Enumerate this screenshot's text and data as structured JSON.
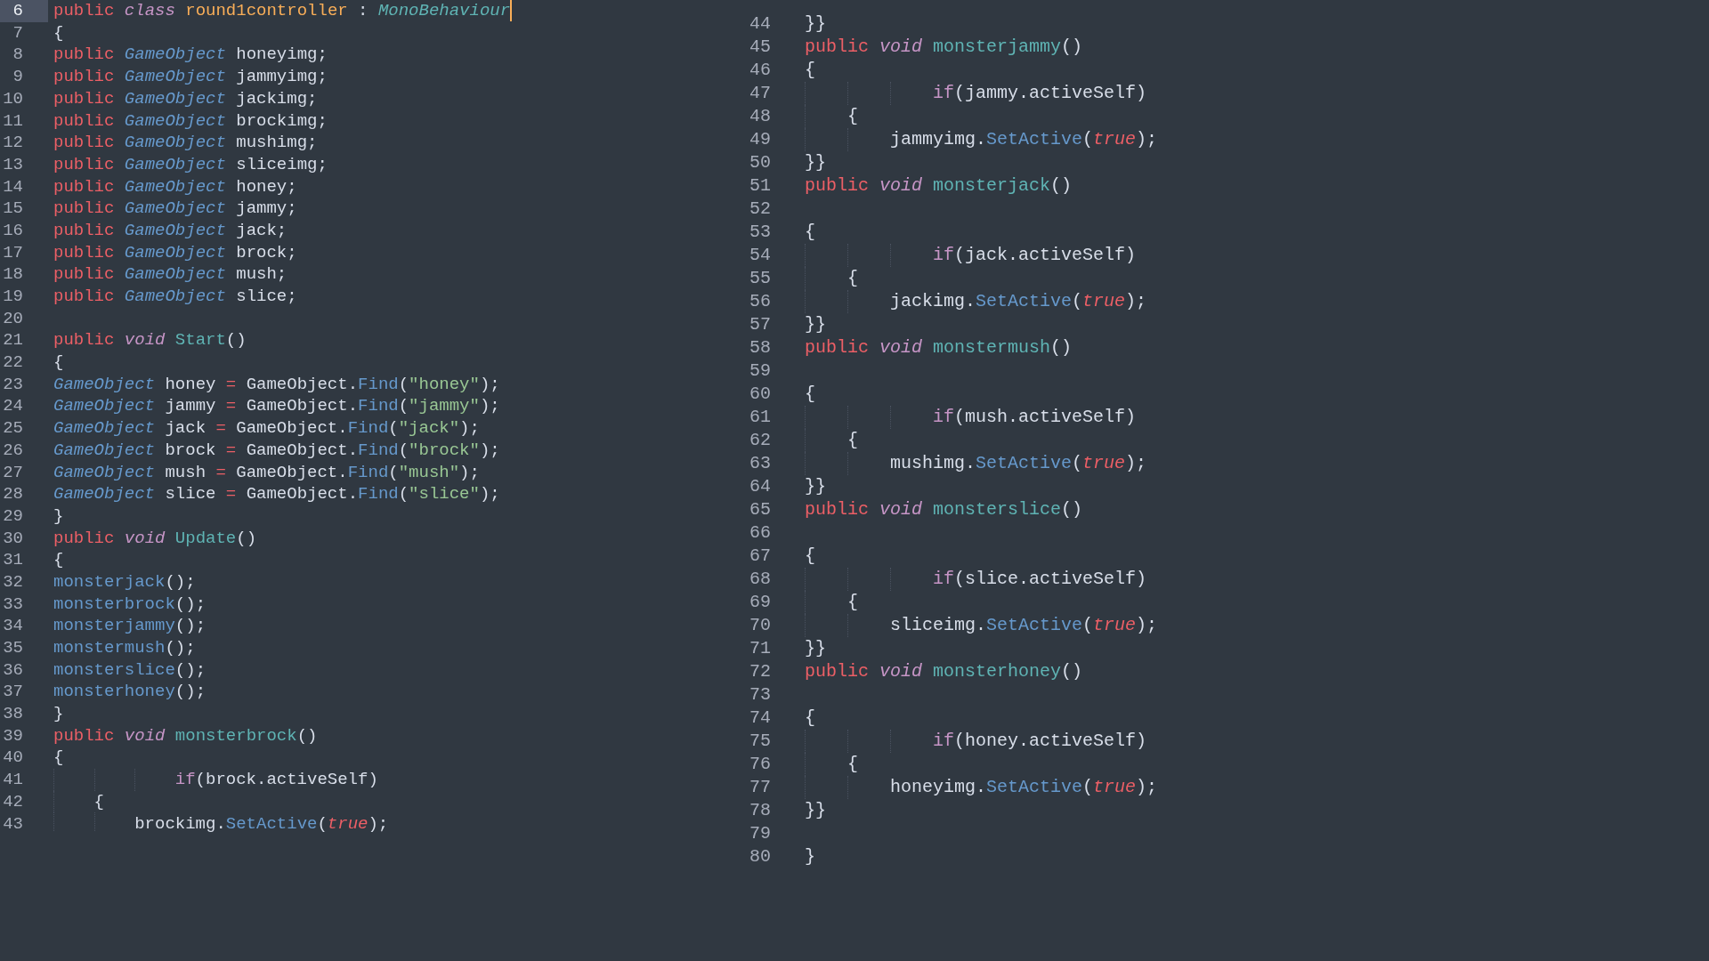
{
  "left_pane": {
    "lines": [
      {
        "number": "6",
        "kind": "top",
        "current": true,
        "tokens": [
          {
            "text": "public ",
            "kind": "kw"
          },
          {
            "text": "class ",
            "kind": "kwi"
          },
          {
            "text": "round1controller ",
            "kind": "cls"
          },
          {
            "text": ": ",
            "kind": "plain"
          },
          {
            "text": "MonoBehaviour",
            "kind": "base"
          }
        ]
      },
      {
        "number": "7",
        "kind": "top",
        "current": false,
        "tokens": [
          {
            "text": "{",
            "kind": "plain"
          }
        ]
      },
      {
        "number": "8",
        "kind": "top",
        "current": false,
        "tokens": [
          {
            "text": "public ",
            "kind": "kw"
          },
          {
            "text": "GameObject ",
            "kind": "type"
          },
          {
            "text": "honeyimg;",
            "kind": "plain"
          }
        ]
      },
      {
        "number": "9",
        "kind": "top",
        "current": false,
        "tokens": [
          {
            "text": "public ",
            "kind": "kw"
          },
          {
            "text": "GameObject ",
            "kind": "type"
          },
          {
            "text": "jammyimg;",
            "kind": "plain"
          }
        ]
      },
      {
        "number": "10",
        "kind": "top",
        "current": false,
        "tokens": [
          {
            "text": "public ",
            "kind": "kw"
          },
          {
            "text": "GameObject ",
            "kind": "type"
          },
          {
            "text": "jackimg;",
            "kind": "plain"
          }
        ]
      },
      {
        "number": "11",
        "kind": "top",
        "current": false,
        "tokens": [
          {
            "text": "public ",
            "kind": "kw"
          },
          {
            "text": "GameObject ",
            "kind": "type"
          },
          {
            "text": "brockimg;",
            "kind": "plain"
          }
        ]
      },
      {
        "number": "12",
        "kind": "top",
        "current": false,
        "tokens": [
          {
            "text": "public ",
            "kind": "kw"
          },
          {
            "text": "GameObject ",
            "kind": "type"
          },
          {
            "text": "mushimg;",
            "kind": "plain"
          }
        ]
      },
      {
        "number": "13",
        "kind": "top",
        "current": false,
        "tokens": [
          {
            "text": "public ",
            "kind": "kw"
          },
          {
            "text": "GameObject ",
            "kind": "type"
          },
          {
            "text": "sliceimg;",
            "kind": "plain"
          }
        ]
      },
      {
        "number": "14",
        "kind": "top",
        "current": false,
        "tokens": [
          {
            "text": "public ",
            "kind": "kw"
          },
          {
            "text": "GameObject ",
            "kind": "type"
          },
          {
            "text": "honey;",
            "kind": "plain"
          }
        ]
      },
      {
        "number": "15",
        "kind": "top",
        "current": false,
        "tokens": [
          {
            "text": "public ",
            "kind": "kw"
          },
          {
            "text": "GameObject ",
            "kind": "type"
          },
          {
            "text": "jammy;",
            "kind": "plain"
          }
        ]
      },
      {
        "number": "16",
        "kind": "top",
        "current": false,
        "tokens": [
          {
            "text": "public ",
            "kind": "kw"
          },
          {
            "text": "GameObject ",
            "kind": "type"
          },
          {
            "text": "jack;",
            "kind": "plain"
          }
        ]
      },
      {
        "number": "17",
        "kind": "top",
        "current": false,
        "tokens": [
          {
            "text": "public ",
            "kind": "kw"
          },
          {
            "text": "GameObject ",
            "kind": "type"
          },
          {
            "text": "brock;",
            "kind": "plain"
          }
        ]
      },
      {
        "number": "18",
        "kind": "top",
        "current": false,
        "tokens": [
          {
            "text": "public ",
            "kind": "kw"
          },
          {
            "text": "GameObject ",
            "kind": "type"
          },
          {
            "text": "mush;",
            "kind": "plain"
          }
        ]
      },
      {
        "number": "19",
        "kind": "top",
        "current": false,
        "tokens": [
          {
            "text": "public ",
            "kind": "kw"
          },
          {
            "text": "GameObject ",
            "kind": "type"
          },
          {
            "text": "slice;",
            "kind": "plain"
          }
        ]
      },
      {
        "number": "20",
        "kind": "top",
        "current": false
      },
      {
        "number": "21",
        "kind": "top",
        "current": false,
        "tokens": [
          {
            "text": "public ",
            "kind": "kw"
          },
          {
            "text": "void ",
            "kind": "kwi"
          },
          {
            "text": "Start",
            "kind": "fn"
          },
          {
            "text": "()",
            "kind": "plain"
          }
        ]
      },
      {
        "number": "22",
        "kind": "top",
        "current": false,
        "tokens": [
          {
            "text": "{",
            "kind": "plain"
          }
        ]
      },
      {
        "number": "23",
        "kind": "top",
        "current": false,
        "tokens": [
          {
            "text": "GameObject ",
            "kind": "type"
          },
          {
            "text": "honey ",
            "kind": "plain"
          },
          {
            "text": "= ",
            "kind": "op"
          },
          {
            "text": "GameObject.",
            "kind": "plain"
          },
          {
            "text": "Find",
            "kind": "call"
          },
          {
            "text": "(",
            "kind": "plain"
          },
          {
            "text": "\"honey\"",
            "kind": "str"
          },
          {
            "text": ");",
            "kind": "plain"
          }
        ]
      },
      {
        "number": "24",
        "kind": "top",
        "current": false,
        "tokens": [
          {
            "text": "GameObject ",
            "kind": "type"
          },
          {
            "text": "jammy ",
            "kind": "plain"
          },
          {
            "text": "= ",
            "kind": "op"
          },
          {
            "text": "GameObject.",
            "kind": "plain"
          },
          {
            "text": "Find",
            "kind": "call"
          },
          {
            "text": "(",
            "kind": "plain"
          },
          {
            "text": "\"jammy\"",
            "kind": "str"
          },
          {
            "text": ");",
            "kind": "plain"
          }
        ]
      },
      {
        "number": "25",
        "kind": "top",
        "current": false,
        "tokens": [
          {
            "text": "GameObject ",
            "kind": "type"
          },
          {
            "text": "jack ",
            "kind": "plain"
          },
          {
            "text": "= ",
            "kind": "op"
          },
          {
            "text": "GameObject.",
            "kind": "plain"
          },
          {
            "text": "Find",
            "kind": "call"
          },
          {
            "text": "(",
            "kind": "plain"
          },
          {
            "text": "\"jack\"",
            "kind": "str"
          },
          {
            "text": ");",
            "kind": "plain"
          }
        ]
      },
      {
        "number": "26",
        "kind": "top",
        "current": false,
        "tokens": [
          {
            "text": "GameObject ",
            "kind": "type"
          },
          {
            "text": "brock ",
            "kind": "plain"
          },
          {
            "text": "= ",
            "kind": "op"
          },
          {
            "text": "GameObject.",
            "kind": "plain"
          },
          {
            "text": "Find",
            "kind": "call"
          },
          {
            "text": "(",
            "kind": "plain"
          },
          {
            "text": "\"brock\"",
            "kind": "str"
          },
          {
            "text": ");",
            "kind": "plain"
          }
        ]
      },
      {
        "number": "27",
        "kind": "top",
        "current": false,
        "tokens": [
          {
            "text": "GameObject ",
            "kind": "type"
          },
          {
            "text": "mush ",
            "kind": "plain"
          },
          {
            "text": "= ",
            "kind": "op"
          },
          {
            "text": "GameObject.",
            "kind": "plain"
          },
          {
            "text": "Find",
            "kind": "call"
          },
          {
            "text": "(",
            "kind": "plain"
          },
          {
            "text": "\"mush\"",
            "kind": "str"
          },
          {
            "text": ");",
            "kind": "plain"
          }
        ]
      },
      {
        "number": "28",
        "kind": "top",
        "current": false,
        "tokens": [
          {
            "text": "GameObject ",
            "kind": "type"
          },
          {
            "text": "slice ",
            "kind": "plain"
          },
          {
            "text": "= ",
            "kind": "op"
          },
          {
            "text": "GameObject.",
            "kind": "plain"
          },
          {
            "text": "Find",
            "kind": "call"
          },
          {
            "text": "(",
            "kind": "plain"
          },
          {
            "text": "\"slice\"",
            "kind": "str"
          },
          {
            "text": ");",
            "kind": "plain"
          }
        ]
      },
      {
        "number": "29",
        "kind": "top",
        "current": false,
        "tokens": [
          {
            "text": "}",
            "kind": "plain"
          }
        ]
      },
      {
        "number": "30",
        "kind": "top",
        "current": false,
        "tokens": [
          {
            "text": "public ",
            "kind": "kw"
          },
          {
            "text": "void ",
            "kind": "kwi"
          },
          {
            "text": "Update",
            "kind": "fn"
          },
          {
            "text": "()",
            "kind": "plain"
          }
        ]
      },
      {
        "number": "31",
        "kind": "top",
        "current": false,
        "tokens": [
          {
            "text": "{",
            "kind": "plain"
          }
        ]
      },
      {
        "number": "32",
        "kind": "top",
        "current": false,
        "tokens": [
          {
            "text": "monsterjack",
            "kind": "call"
          },
          {
            "text": "();",
            "kind": "plain"
          }
        ]
      },
      {
        "number": "33",
        "kind": "top",
        "current": false,
        "tokens": [
          {
            "text": "monsterbrock",
            "kind": "call"
          },
          {
            "text": "();",
            "kind": "plain"
          }
        ]
      },
      {
        "number": "34",
        "kind": "top",
        "current": false,
        "tokens": [
          {
            "text": "monsterjammy",
            "kind": "call"
          },
          {
            "text": "();",
            "kind": "plain"
          }
        ]
      },
      {
        "number": "35",
        "kind": "top",
        "current": false,
        "tokens": [
          {
            "text": "monstermush",
            "kind": "call"
          },
          {
            "text": "();",
            "kind": "plain"
          }
        ]
      },
      {
        "number": "36",
        "kind": "top",
        "current": false,
        "tokens": [
          {
            "text": "monsterslice",
            "kind": "call"
          },
          {
            "text": "();",
            "kind": "plain"
          }
        ]
      },
      {
        "number": "37",
        "kind": "top",
        "current": false,
        "tokens": [
          {
            "text": "monsterhoney",
            "kind": "call"
          },
          {
            "text": "();",
            "kind": "plain"
          }
        ]
      },
      {
        "number": "38",
        "kind": "top",
        "current": false,
        "tokens": [
          {
            "text": "}",
            "kind": "plain"
          }
        ]
      },
      {
        "number": "39",
        "kind": "top",
        "current": false,
        "tokens": [
          {
            "text": "public ",
            "kind": "kw"
          },
          {
            "text": "void ",
            "kind": "kwi"
          },
          {
            "text": "monsterbrock",
            "kind": "fn"
          },
          {
            "text": "()",
            "kind": "plain"
          }
        ]
      },
      {
        "number": "40",
        "kind": "top",
        "current": false,
        "tokens": [
          {
            "text": "{",
            "kind": "plain"
          }
        ]
      },
      {
        "number": "41",
        "kind": "condition",
        "current": false,
        "tokens": [
          {
            "text": "if",
            "kind": "ctrl"
          },
          {
            "text": "(brock.activeSelf)",
            "kind": "plain"
          }
        ]
      },
      {
        "number": "42",
        "kind": "brace",
        "current": false,
        "tokens": [
          {
            "text": "{",
            "kind": "plain"
          }
        ]
      },
      {
        "number": "43",
        "kind": "statement",
        "current": false,
        "tokens": [
          {
            "text": "brockimg.",
            "kind": "plain"
          },
          {
            "text": "SetActive",
            "kind": "call"
          },
          {
            "text": "(",
            "kind": "plain"
          },
          {
            "text": "true",
            "kind": "bool"
          },
          {
            "text": ");",
            "kind": "plain"
          }
        ]
      }
    ]
  },
  "right_pane": {
    "lines": [
      {
        "number": "44",
        "kind": "top",
        "current": false,
        "tokens": [
          {
            "text": "}}",
            "kind": "plain"
          }
        ]
      },
      {
        "number": "45",
        "kind": "top",
        "current": false,
        "tokens": [
          {
            "text": "public ",
            "kind": "kw"
          },
          {
            "text": "void ",
            "kind": "kwi"
          },
          {
            "text": "monsterjammy",
            "kind": "fn"
          },
          {
            "text": "()",
            "kind": "plain"
          }
        ]
      },
      {
        "number": "46",
        "kind": "top",
        "current": false,
        "tokens": [
          {
            "text": "{",
            "kind": "plain"
          }
        ]
      },
      {
        "number": "47",
        "kind": "condition",
        "current": false,
        "tokens": [
          {
            "text": "if",
            "kind": "ctrl"
          },
          {
            "text": "(jammy.activeSelf)",
            "kind": "plain"
          }
        ]
      },
      {
        "number": "48",
        "kind": "brace",
        "current": false,
        "tokens": [
          {
            "text": "{",
            "kind": "plain"
          }
        ]
      },
      {
        "number": "49",
        "kind": "statement",
        "current": false,
        "tokens": [
          {
            "text": "jammyimg.",
            "kind": "plain"
          },
          {
            "text": "SetActive",
            "kind": "call"
          },
          {
            "text": "(",
            "kind": "plain"
          },
          {
            "text": "true",
            "kind": "bool"
          },
          {
            "text": ");",
            "kind": "plain"
          }
        ]
      },
      {
        "number": "50",
        "kind": "top",
        "current": false,
        "tokens": [
          {
            "text": "}}",
            "kind": "plain"
          }
        ]
      },
      {
        "number": "51",
        "kind": "top",
        "current": false,
        "tokens": [
          {
            "text": "public ",
            "kind": "kw"
          },
          {
            "text": "void ",
            "kind": "kwi"
          },
          {
            "text": "monsterjack",
            "kind": "fn"
          },
          {
            "text": "()",
            "kind": "plain"
          }
        ]
      },
      {
        "number": "52",
        "kind": "top",
        "current": false
      },
      {
        "number": "53",
        "kind": "top",
        "current": false,
        "tokens": [
          {
            "text": "{",
            "kind": "plain"
          }
        ]
      },
      {
        "number": "54",
        "kind": "condition",
        "current": false,
        "tokens": [
          {
            "text": "if",
            "kind": "ctrl"
          },
          {
            "text": "(jack.activeSelf)",
            "kind": "plain"
          }
        ]
      },
      {
        "number": "55",
        "kind": "brace",
        "current": false,
        "tokens": [
          {
            "text": "{",
            "kind": "plain"
          }
        ]
      },
      {
        "number": "56",
        "kind": "statement",
        "current": false,
        "tokens": [
          {
            "text": "jackimg.",
            "kind": "plain"
          },
          {
            "text": "SetActive",
            "kind": "call"
          },
          {
            "text": "(",
            "kind": "plain"
          },
          {
            "text": "true",
            "kind": "bool"
          },
          {
            "text": ");",
            "kind": "plain"
          }
        ]
      },
      {
        "number": "57",
        "kind": "top",
        "current": false,
        "tokens": [
          {
            "text": "}}",
            "kind": "plain"
          }
        ]
      },
      {
        "number": "58",
        "kind": "top",
        "current": false,
        "tokens": [
          {
            "text": "public ",
            "kind": "kw"
          },
          {
            "text": "void ",
            "kind": "kwi"
          },
          {
            "text": "monstermush",
            "kind": "fn"
          },
          {
            "text": "()",
            "kind": "plain"
          }
        ]
      },
      {
        "number": "59",
        "kind": "top",
        "current": false
      },
      {
        "number": "60",
        "kind": "top",
        "current": false,
        "tokens": [
          {
            "text": "{",
            "kind": "plain"
          }
        ]
      },
      {
        "number": "61",
        "kind": "condition",
        "current": false,
        "tokens": [
          {
            "text": "if",
            "kind": "ctrl"
          },
          {
            "text": "(mush.activeSelf)",
            "kind": "plain"
          }
        ]
      },
      {
        "number": "62",
        "kind": "brace",
        "current": false,
        "tokens": [
          {
            "text": "{",
            "kind": "plain"
          }
        ]
      },
      {
        "number": "63",
        "kind": "statement",
        "current": false,
        "tokens": [
          {
            "text": "mushimg.",
            "kind": "plain"
          },
          {
            "text": "SetActive",
            "kind": "call"
          },
          {
            "text": "(",
            "kind": "plain"
          },
          {
            "text": "true",
            "kind": "bool"
          },
          {
            "text": ");",
            "kind": "plain"
          }
        ]
      },
      {
        "number": "64",
        "kind": "top",
        "current": false,
        "tokens": [
          {
            "text": "}}",
            "kind": "plain"
          }
        ]
      },
      {
        "number": "65",
        "kind": "top",
        "current": false,
        "tokens": [
          {
            "text": "public ",
            "kind": "kw"
          },
          {
            "text": "void ",
            "kind": "kwi"
          },
          {
            "text": "monsterslice",
            "kind": "fn"
          },
          {
            "text": "()",
            "kind": "plain"
          }
        ]
      },
      {
        "number": "66",
        "kind": "top",
        "current": false
      },
      {
        "number": "67",
        "kind": "top",
        "current": false,
        "tokens": [
          {
            "text": "{",
            "kind": "plain"
          }
        ]
      },
      {
        "number": "68",
        "kind": "condition",
        "current": false,
        "tokens": [
          {
            "text": "if",
            "kind": "ctrl"
          },
          {
            "text": "(slice.activeSelf)",
            "kind": "plain"
          }
        ]
      },
      {
        "number": "69",
        "kind": "brace",
        "current": false,
        "tokens": [
          {
            "text": "{",
            "kind": "plain"
          }
        ]
      },
      {
        "number": "70",
        "kind": "statement",
        "current": false,
        "tokens": [
          {
            "text": "sliceimg.",
            "kind": "plain"
          },
          {
            "text": "SetActive",
            "kind": "call"
          },
          {
            "text": "(",
            "kind": "plain"
          },
          {
            "text": "true",
            "kind": "bool"
          },
          {
            "text": ");",
            "kind": "plain"
          }
        ]
      },
      {
        "number": "71",
        "kind": "top",
        "current": false,
        "tokens": [
          {
            "text": "}}",
            "kind": "plain"
          }
        ]
      },
      {
        "number": "72",
        "kind": "top",
        "current": false,
        "tokens": [
          {
            "text": "public ",
            "kind": "kw"
          },
          {
            "text": "void ",
            "kind": "kwi"
          },
          {
            "text": "monsterhoney",
            "kind": "fn"
          },
          {
            "text": "()",
            "kind": "plain"
          }
        ]
      },
      {
        "number": "73",
        "kind": "top",
        "current": false
      },
      {
        "number": "74",
        "kind": "top",
        "current": false,
        "tokens": [
          {
            "text": "{",
            "kind": "plain"
          }
        ]
      },
      {
        "number": "75",
        "kind": "condition",
        "current": false,
        "tokens": [
          {
            "text": "if",
            "kind": "ctrl"
          },
          {
            "text": "(honey.activeSelf)",
            "kind": "plain"
          }
        ]
      },
      {
        "number": "76",
        "kind": "brace",
        "current": false,
        "tokens": [
          {
            "text": "{",
            "kind": "plain"
          }
        ]
      },
      {
        "number": "77",
        "kind": "statement",
        "current": false,
        "tokens": [
          {
            "text": "honeyimg.",
            "kind": "plain"
          },
          {
            "text": "SetActive",
            "kind": "call"
          },
          {
            "text": "(",
            "kind": "plain"
          },
          {
            "text": "true",
            "kind": "bool"
          },
          {
            "text": ");",
            "kind": "plain"
          }
        ]
      },
      {
        "number": "78",
        "kind": "top",
        "current": false,
        "tokens": [
          {
            "text": "}}",
            "kind": "plain"
          }
        ]
      },
      {
        "number": "79",
        "kind": "top",
        "current": false
      },
      {
        "number": "80",
        "kind": "top",
        "current": false,
        "tokens": [
          {
            "text": "}",
            "kind": "plain"
          }
        ]
      }
    ]
  }
}
